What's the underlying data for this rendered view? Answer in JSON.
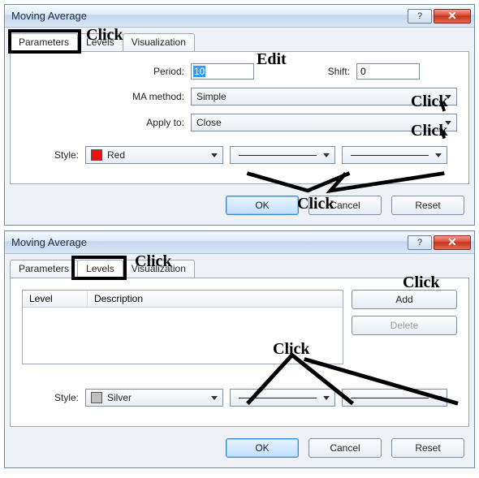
{
  "dialog1": {
    "title": "Moving Average",
    "tabs": {
      "parameters": "Parameters",
      "levels": "Levels",
      "visualization": "Visualization"
    },
    "labels": {
      "period": "Period:",
      "shift": "Shift:",
      "ma_method": "MA method:",
      "apply_to": "Apply to:",
      "style": "Style:"
    },
    "values": {
      "period": "10",
      "shift": "0",
      "ma_method": "Simple",
      "apply_to": "Close",
      "style_color": "Red"
    },
    "buttons": {
      "ok": "OK",
      "cancel": "Cancel",
      "reset": "Reset"
    }
  },
  "dialog2": {
    "title": "Moving Average",
    "tabs": {
      "parameters": "Parameters",
      "levels": "Levels",
      "visualization": "Visualization"
    },
    "list": {
      "col_level": "Level",
      "col_desc": "Description"
    },
    "labels": {
      "style": "Style:"
    },
    "values": {
      "style_color": "Silver"
    },
    "side": {
      "add": "Add",
      "delete": "Delete"
    },
    "buttons": {
      "ok": "OK",
      "cancel": "Cancel",
      "reset": "Reset"
    }
  },
  "annotations": {
    "click": "Click",
    "edit": "Edit"
  }
}
